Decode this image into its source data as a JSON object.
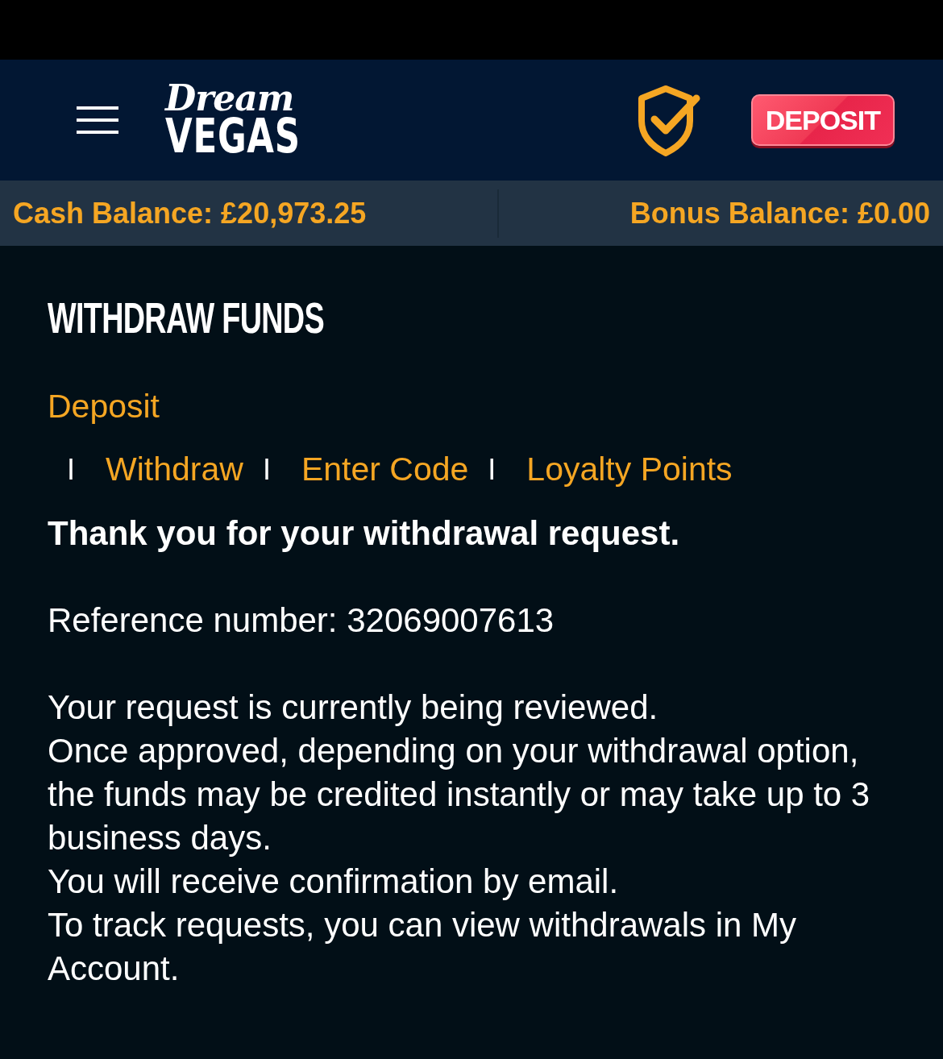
{
  "header": {
    "logo_top": "Dream",
    "logo_bottom": "VEGAS",
    "deposit_button": "DEPOSIT"
  },
  "balances": {
    "cash": "Cash Balance: £20,973.25",
    "bonus": "Bonus Balance: £0.00"
  },
  "title": "WITHDRAW FUNDS",
  "nav_rows": [
    [
      {
        "kind": "link",
        "text": "Deposit"
      }
    ],
    [
      {
        "kind": "separator",
        "text": "I"
      },
      {
        "kind": "link",
        "text": "Withdraw"
      },
      {
        "kind": "separator",
        "text": "I"
      },
      {
        "kind": "link",
        "text": "Enter Code"
      },
      {
        "kind": "separator",
        "text": "I"
      },
      {
        "kind": "link",
        "text": "Loyalty Points"
      }
    ]
  ],
  "message": {
    "heading": "Thank you for your withdrawal request.",
    "reference": "Reference number: 32069007613",
    "lines": [
      "Your request is currently being reviewed.",
      "Once approved, depending on your withdrawal option, the funds may be credited instantly or may take up to 3 business days.",
      "You will receive confirmation by email.",
      "To track requests, you can view withdrawals in My Account."
    ]
  }
}
